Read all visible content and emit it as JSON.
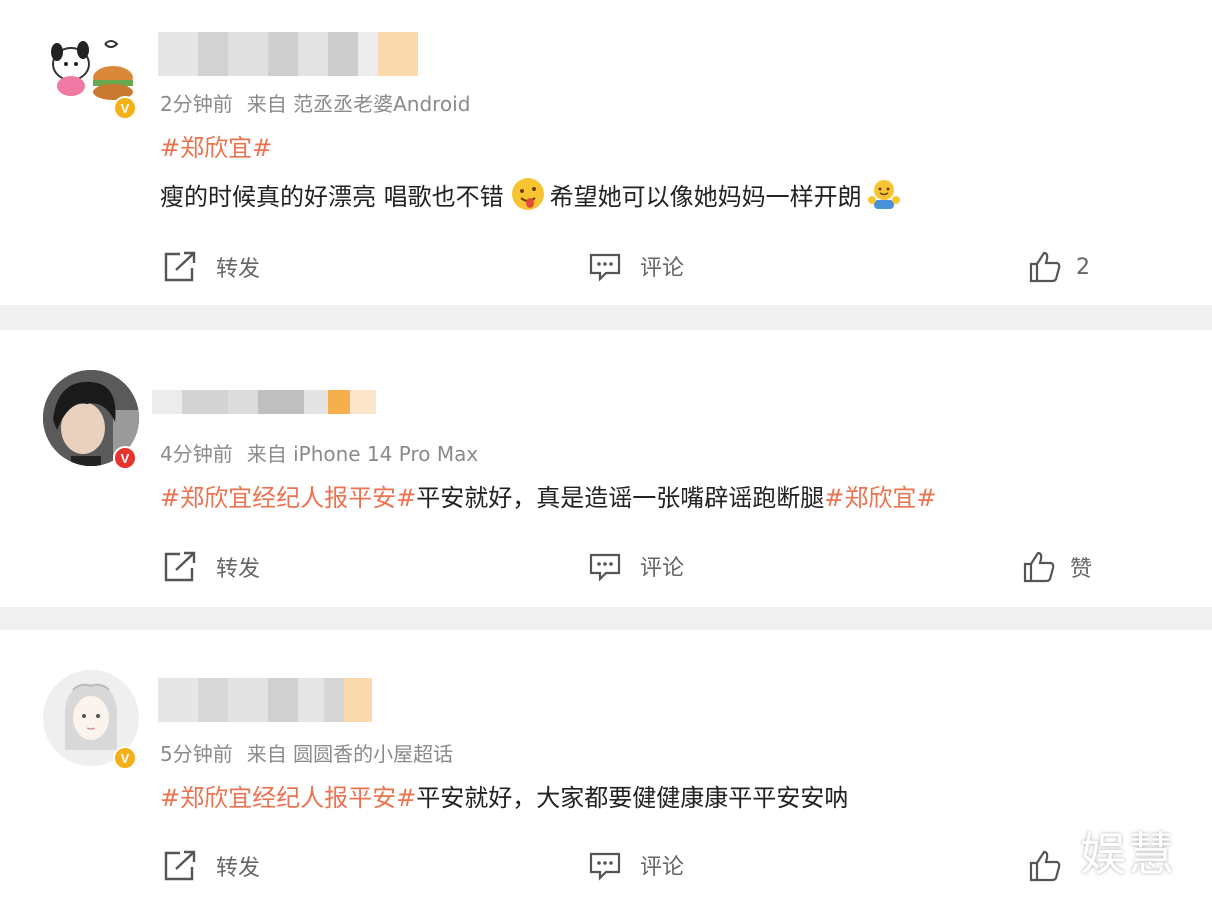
{
  "comments": [
    {
      "time": "2分钟前",
      "source": "来自 范丞丞老婆Android",
      "tags_before": "#郑欣宜#",
      "text_1": "瘦的时候真的好漂亮 唱歌也不错",
      "text_2": "希望她可以像她妈妈一样开朗",
      "emoji_1": "tongue-out-emoji",
      "emoji_2": "hug-emoji",
      "verified_badge": "gold",
      "repost_label": "转发",
      "comment_label": "评论",
      "like_label": "2"
    },
    {
      "time": "4分钟前",
      "source": "来自 iPhone 14 Pro Max",
      "tag_1": "#郑欣宜经纪人报平安#",
      "text": "平安就好，真是造谣一张嘴辟谣跑断腿",
      "tag_2": "#郑欣宜#",
      "verified_badge": "red",
      "repost_label": "转发",
      "comment_label": "评论",
      "like_label": "赞"
    },
    {
      "time": "5分钟前",
      "source": "来自 圆圆香的小屋超话",
      "tag_1": "#郑欣宜经纪人报平安#",
      "text": "平安就好，大家都要健健康康平平安安呐",
      "verified_badge": "gold",
      "repost_label": "转发",
      "comment_label": "评论",
      "like_label": ""
    }
  ],
  "watermark": "娱慧",
  "colors": {
    "hashtag": "#eb7350",
    "meta": "#8a8a8a",
    "text": "#222222",
    "separator": "#f0f0f0"
  }
}
